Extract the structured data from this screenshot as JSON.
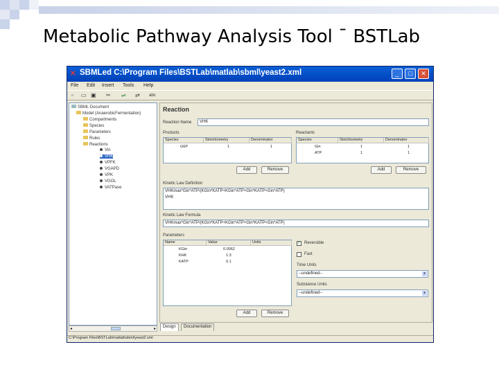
{
  "slide": {
    "title": "Metabolic Pathway Analysis Tool ¯ BSTLab"
  },
  "window": {
    "title": "SBMLed C:\\Program Files\\BSTLab\\matlab\\sbml\\yeast2.xml",
    "controls": [
      "_",
      "□",
      "✕"
    ]
  },
  "menubar": [
    "File",
    "Edit",
    "Insert",
    "Tools",
    "Help"
  ],
  "toolbar": {
    "icons": [
      "new-icon",
      "open-icon",
      "save-icon",
      "cut-icon",
      "add-reaction-icon",
      "reaction-text-icon"
    ]
  },
  "tree": {
    "root": "SBML Document",
    "model": "Model (AnaerobicFermentation)",
    "folders": [
      "Compartments",
      "Species",
      "Parameters",
      "Rules",
      "Reactions"
    ],
    "reactions": [
      "Vin",
      "VHK",
      "VPFK",
      "VGAPD",
      "VPK",
      "VGOL",
      "VATPase"
    ]
  },
  "panel": {
    "heading": "Reaction",
    "reaction_name_label": "Reaction Name",
    "reaction_name_value": "VHK",
    "products": {
      "label": "Products",
      "columns": [
        "Species",
        "Stoichiometry",
        "Denominator"
      ],
      "rows": [
        {
          "species": "G6P",
          "stoich": "1",
          "denom": "1"
        }
      ]
    },
    "reactants": {
      "label": "Reactants",
      "columns": [
        "Species",
        "Stoichiometry",
        "Denominator"
      ],
      "rows": [
        {
          "species": "Gin",
          "stoich": "1",
          "denom": "1"
        },
        {
          "species": "ATP",
          "stoich": "1",
          "denom": "1"
        }
      ]
    },
    "add_label": "Add",
    "remove_label": "Remove",
    "kinetic_law_label": "Kinetic Law Definition",
    "kinetic_law_line1": "VHKmax*Gin*ATP/(KGin*KATP+KGin*ATP+Gin*KATP+Gin*ATP)",
    "kinetic_law_line2": "VHK",
    "kinetic_formula_label": "Kinetic Law Formula",
    "kinetic_formula_value": "VHKmax*Gin*ATP/(KGin*KATP+KGin*ATP+Gin*KATP+Gin*ATP)",
    "parameters": {
      "label": "Parameters",
      "columns": [
        "Name",
        "Value",
        "Units"
      ],
      "rows": [
        {
          "name": "KGin",
          "value": "0.0062",
          "units": ""
        },
        {
          "name": "KHK",
          "value": "1.3",
          "units": ""
        },
        {
          "name": "KATP",
          "value": "0.1",
          "units": ""
        }
      ]
    },
    "reversible_label": "Reversible",
    "reversible_checked": "✓",
    "fast_label": "Fast",
    "time_units_label": "Time Units",
    "time_units_value": "--undefined--",
    "substance_units_label": "Substance Units",
    "substance_units_value": "--undefined--"
  },
  "tree_scroll": {
    "left": "◂",
    "right": "▸"
  },
  "tabs": [
    "Design",
    "Documentation"
  ],
  "status": "C:\\Program Files\\BSTLab\\matlab\\sbml\\yeast2.xml"
}
